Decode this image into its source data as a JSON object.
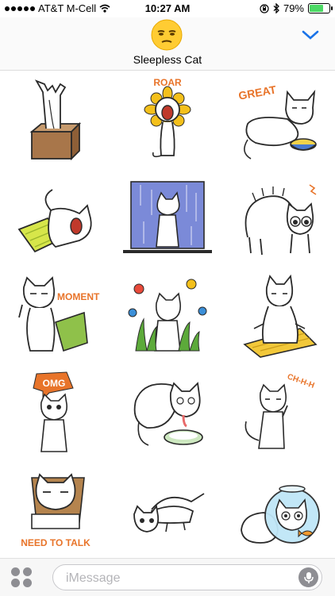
{
  "status_bar": {
    "carrier": "AT&T M-Cell",
    "time": "10:27 AM",
    "battery": "79%",
    "battery_level": 0.79,
    "icons": [
      "signal-dots-icon",
      "wifi-icon",
      "orientation-lock-icon",
      "bluetooth-icon",
      "battery-icon"
    ]
  },
  "header": {
    "app_name": "Sleepless Cat",
    "app_icon": "sleepy-face-emoji-icon",
    "collapse_icon": "chevron-down-icon"
  },
  "stickers": [
    {
      "name": "cat-in-box-sticker",
      "caption": ""
    },
    {
      "name": "sunflower-cat-roar-sticker",
      "caption": "ROAR"
    },
    {
      "name": "cat-great-cereal-sticker",
      "caption": "GREAT"
    },
    {
      "name": "cat-yawning-pillow-sticker",
      "caption": ""
    },
    {
      "name": "cat-in-rain-sticker",
      "caption": ""
    },
    {
      "name": "scared-cat-arched-sticker",
      "caption": ""
    },
    {
      "name": "cat-moment-sticker",
      "caption": "MOMENT"
    },
    {
      "name": "cat-in-flowers-sticker",
      "caption": ""
    },
    {
      "name": "cat-meditating-mat-sticker",
      "caption": ""
    },
    {
      "name": "cat-omg-sticker",
      "caption": "OMG"
    },
    {
      "name": "cat-drinking-milk-sticker",
      "caption": ""
    },
    {
      "name": "cat-chhh-sticker",
      "caption": "CH-H-H"
    },
    {
      "name": "cat-need-to-talk-sticker",
      "caption": "NEED TO TALK"
    },
    {
      "name": "cat-crawling-sticker",
      "caption": ""
    },
    {
      "name": "cat-fishbowl-sticker",
      "caption": ""
    }
  ],
  "input_bar": {
    "apps_icon": "app-drawer-icon",
    "placeholder": "iMessage",
    "mic_icon": "microphone-icon"
  },
  "colors": {
    "orange": "#e8742a",
    "outline": "#2a2a2a",
    "green": "#4cd964",
    "blue": "#3b6fd8"
  }
}
